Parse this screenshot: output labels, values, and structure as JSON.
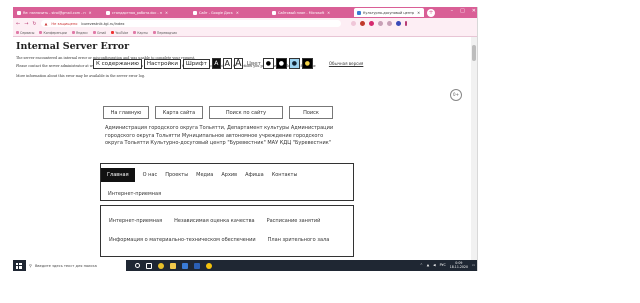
{
  "browser": {
    "tabs": [
      {
        "label": "Re: назначить - stroi@gmail.com - п"
      },
      {
        "label": "стандартная_работа.doc - п"
      },
      {
        "label": "Сайт - Google Диск"
      },
      {
        "label": "Сайтовый план - Microsoft"
      },
      {
        "label": "Культурно-досуговый центр",
        "active": true
      }
    ],
    "new_tab": "+",
    "window_controls": [
      "–",
      "□",
      "✕"
    ],
    "url_warning": "Не защищено",
    "url": "burevestnik-tgl.ru/index",
    "bookmarks": [
      "Сервисы",
      "Конференции",
      "Яндекс",
      "Gmail",
      "YouTube",
      "Карты",
      "Переводчик"
    ]
  },
  "page": {
    "error_title": "Internal Server Error",
    "error_lines": [
      "The server encountered an internal error or misconfiguration and was unable to complete your request.",
      "Please contact the server administrator at webmaster@burevestnik-tgl.ru to inform them of the time this error occurred, and the actions you performed just before this error.",
      "More information about this error may be available in the server error log."
    ],
    "accessibility": {
      "skip_link": "К содержанию",
      "settings": "Настройки",
      "font_label": "Шрифт",
      "font_sizes": [
        "A",
        "A",
        "A"
      ],
      "color_label": "Цвет",
      "color_options": [
        "●",
        "●",
        "●",
        "●"
      ],
      "regular_version": "Обычная версия"
    },
    "eye_icon_label": "0+",
    "top_nav": [
      "На главную",
      "Карта сайта",
      "Поиск по сайту",
      "Поиск"
    ],
    "orgs_text": "Администрация городского округа Тольятти, Департамент культуры Администрации городского округа Тольятти Муниципальное автономное учреждение городского округа Тольятти Культурно-досуговый центр \"Буревестник\" МАУ КДЦ \"Буревестник\"",
    "main_nav": [
      "Главная",
      "О нас",
      "Проекты",
      "Медиа",
      "Архив",
      "Афиша",
      "Контакты"
    ],
    "main_nav_second_row": "Интернет-приемная",
    "sub_nav_row1": [
      "Интернет-приемная",
      "Независимая оценка качества",
      "Расписание занятий"
    ],
    "sub_nav_row2": [
      "Информация о материально-техническом обеспечении",
      "План зрительного зала"
    ]
  },
  "taskbar": {
    "search_placeholder": "Введите здесь текст для поиска",
    "lang": "РУС",
    "time": "0:09",
    "date": "18.11.2020"
  },
  "colors": {
    "tab_strip": "#d95f96",
    "taskbar": "#1f2733"
  }
}
